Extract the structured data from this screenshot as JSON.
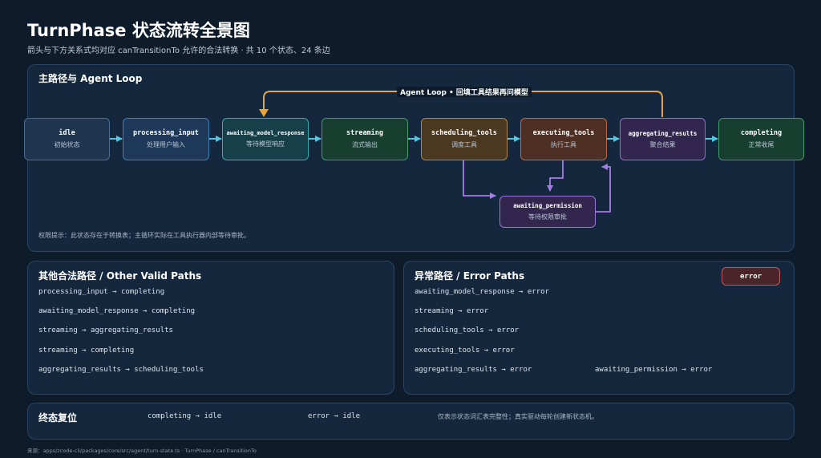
{
  "title": "TurnPhase 状态流转全景图",
  "subtitle": "箭头与下方关系式均对应 canTransitionTo 允许的合法转换 · 共 10 个状态、24 条边",
  "main_panel": {
    "title": "主路径与 Agent Loop",
    "loop_label": "Agent Loop • 回填工具结果再问模型",
    "permission_note": "权限提示：此状态存在于转换表；主循环实际在工具执行器内部等待审批。",
    "nodes": {
      "idle": {
        "name": "idle",
        "cn": "初始状态"
      },
      "processing_input": {
        "name": "processing_input",
        "cn": "处理用户输入"
      },
      "awaiting_model_response": {
        "name": "awaiting_model_response",
        "cn": "等待模型响应"
      },
      "streaming": {
        "name": "streaming",
        "cn": "流式输出"
      },
      "scheduling_tools": {
        "name": "scheduling_tools",
        "cn": "调度工具"
      },
      "executing_tools": {
        "name": "executing_tools",
        "cn": "执行工具"
      },
      "aggregating_results": {
        "name": "aggregating_results",
        "cn": "聚合结果"
      },
      "completing": {
        "name": "completing",
        "cn": "正常收尾"
      },
      "awaiting_permission": {
        "name": "awaiting_permission",
        "cn": "等待权限审批"
      }
    }
  },
  "other_paths": {
    "title": "其他合法路径 / Other Valid Paths",
    "items": [
      "processing_input → completing",
      "awaiting_model_response → completing",
      "streaming → aggregating_results",
      "streaming → completing",
      "aggregating_results → scheduling_tools"
    ]
  },
  "error_paths": {
    "title": "异常路径 / Error Paths",
    "badge": "error",
    "items": [
      "awaiting_model_response → error",
      "streaming → error",
      "scheduling_tools → error",
      "executing_tools → error",
      "aggregating_results → error",
      "awaiting_permission → error"
    ]
  },
  "reset": {
    "title": "终态复位",
    "items": [
      "completing → idle",
      "error → idle"
    ],
    "note": "仅表示状态词汇表完整性；真实驱动每轮创建新状态机。"
  },
  "source": "来源：apps/zcode-cli/packages/core/src/agent/turn-state.ts · TurnPhase / canTransitionTo",
  "colors": {
    "arrow": "#56c6e0",
    "loop": "#e8a33c",
    "permission": "#a57be8",
    "background": "#0d1b2a"
  }
}
